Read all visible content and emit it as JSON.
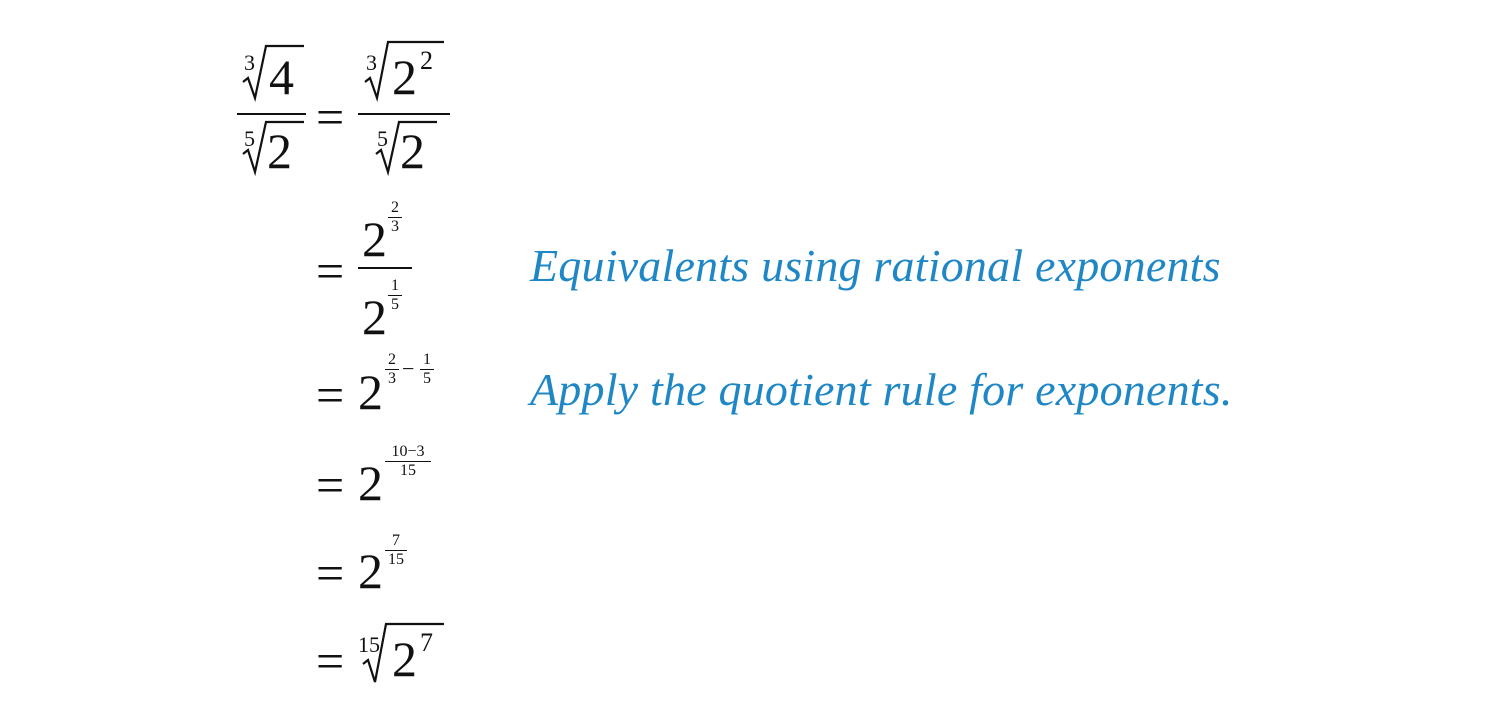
{
  "derivation": {
    "lhs": {
      "numerator": {
        "index": "3",
        "radicand": "4"
      },
      "denominator": {
        "index": "5",
        "radicand": "2"
      }
    },
    "steps": [
      {
        "equals": "=",
        "numerator": {
          "index": "3",
          "base": "2",
          "exponent": "2"
        },
        "denominator": {
          "index": "5",
          "radicand": "2"
        },
        "note": ""
      },
      {
        "equals": "=",
        "numerator": {
          "base": "2",
          "exp_num": "2",
          "exp_den": "3"
        },
        "denominator": {
          "base": "2",
          "exp_num": "1",
          "exp_den": "5"
        },
        "note": "Equivalents using rational exponents"
      },
      {
        "equals": "=",
        "base": "2",
        "exp_a_num": "2",
        "exp_a_den": "3",
        "minus": "−",
        "exp_b_num": "1",
        "exp_b_den": "5",
        "note": "Apply the quotient rule for exponents."
      },
      {
        "equals": "=",
        "base": "2",
        "exp_num": "10−3",
        "exp_den": "15",
        "note": ""
      },
      {
        "equals": "=",
        "base": "2",
        "exp_num": "7",
        "exp_den": "15",
        "note": ""
      },
      {
        "equals": "=",
        "index": "15",
        "base": "2",
        "exponent": "7",
        "note": ""
      }
    ]
  },
  "colors": {
    "math": "#111111",
    "annotation": "#1f87c6"
  }
}
